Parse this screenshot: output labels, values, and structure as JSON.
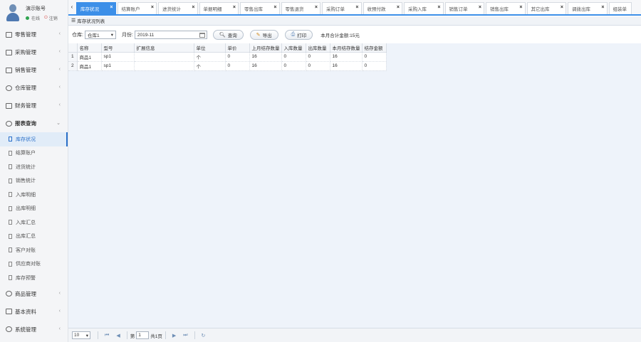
{
  "user": {
    "name": "演示账号",
    "status": "在线",
    "logout": "注销"
  },
  "sidebar": {
    "groups_top": [
      {
        "label": "零售管理",
        "icon": "store-icon"
      },
      {
        "label": "采购管理",
        "icon": "cart-icon"
      },
      {
        "label": "销售管理",
        "icon": "sales-icon"
      },
      {
        "label": "仓库管理",
        "icon": "gear-icon"
      },
      {
        "label": "财务管理",
        "icon": "finance-icon"
      }
    ],
    "open_group": {
      "label": "报表查询",
      "icon": "clock-icon"
    },
    "sub_items": [
      "库存状况",
      "结算账户",
      "进货统计",
      "销售统计",
      "入库明细",
      "出库明细",
      "入库汇总",
      "出库汇总",
      "客户对账",
      "供应商对账",
      "库存预警"
    ],
    "groups_bottom": [
      {
        "label": "商品管理",
        "icon": "goods-icon"
      },
      {
        "label": "基本资料",
        "icon": "grid-icon"
      },
      {
        "label": "系统管理",
        "icon": "settings-icon"
      }
    ]
  },
  "tabs": [
    "库存状况",
    "结算账户",
    "进货统计",
    "单据明细",
    "零售出库",
    "零售退货",
    "采购订单",
    "收预付款",
    "采购入库",
    "销售订单",
    "销售出库",
    "其它出库",
    "调拨出库",
    "组装单"
  ],
  "panel": {
    "title": "库存状况列表"
  },
  "toolbar": {
    "warehouse_label": "仓库:",
    "warehouse_value": "仓库1",
    "month_label": "月份:",
    "month_value": "2019-11",
    "query_label": "查询",
    "export_label": "导出",
    "print_label": "打印",
    "total_text": "本月合计金额:15元"
  },
  "table": {
    "columns": [
      "名称",
      "型号",
      "扩展信息",
      "单位",
      "单价",
      "上月结存数量",
      "入库数量",
      "出库数量",
      "本月结存数量",
      "结存金额"
    ],
    "rows": [
      [
        "1",
        "商品1",
        "sp1",
        "",
        "个",
        "0",
        "16",
        "0",
        "0",
        "16",
        "0"
      ],
      [
        "2",
        "商品1",
        "sp1",
        "",
        "个",
        "0",
        "16",
        "0",
        "0",
        "16",
        "0"
      ]
    ]
  },
  "pager": {
    "page_size": "10",
    "page_prefix": "第",
    "page_value": "1",
    "page_suffix": "共1页"
  }
}
